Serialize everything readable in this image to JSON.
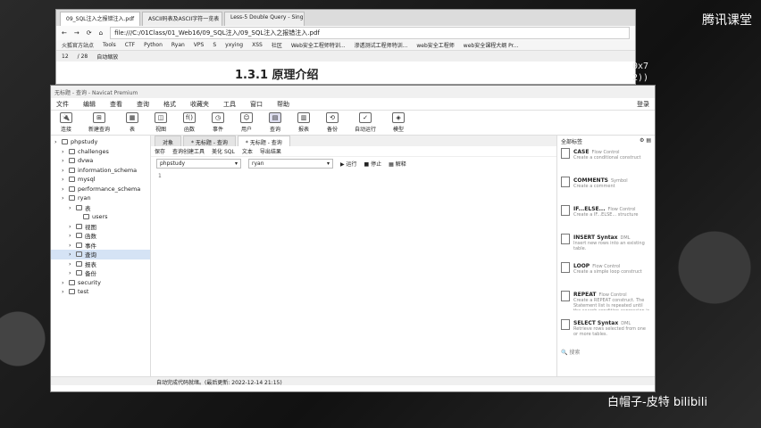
{
  "browser": {
    "tabs": [
      "09_SQL注入之报错注入.pdf",
      "ASCII码表及ASCII字符一览表",
      "Less-5 Double Query - Single Qu"
    ],
    "url": "file:///C:/01Class/01_Web16/09_SQL注入/09_SQL注入之报错注入.pdf",
    "bookmarks": [
      "火狐官方站点",
      "Tools",
      "CTF",
      "Python",
      "Ryan",
      "VPS",
      "S",
      "yxying",
      "XSS",
      "社区",
      "Web安全工程师特训...",
      "渗透测试工程师特训...",
      "web安全工程师",
      "web安全课程大纲 Pr..."
    ],
    "pdf_page": "12",
    "pdf_total": "/ 28",
    "pdf_zoom": "自动缩放",
    "pdf_heading": "1.3.1 原理介绍",
    "watermark": "腾讯课堂",
    "pinyin": "0x7\n2))"
  },
  "navicat": {
    "title": "无标题 - 查询 - Navicat Premium",
    "menu": [
      "文件",
      "编辑",
      "查看",
      "查询",
      "格式",
      "收藏夹",
      "工具",
      "窗口",
      "帮助"
    ],
    "login": "登录",
    "toolbar": [
      {
        "label": "连接",
        "icon": "🔌"
      },
      {
        "label": "新建查询",
        "icon": "⊞"
      },
      {
        "label": "表",
        "icon": "▦"
      },
      {
        "label": "视图",
        "icon": "◫"
      },
      {
        "label": "函数",
        "icon": "f()"
      },
      {
        "label": "事件",
        "icon": "◷"
      },
      {
        "label": "用户",
        "icon": "☺"
      },
      {
        "label": "查询",
        "icon": "▤"
      },
      {
        "label": "报表",
        "icon": "▥"
      },
      {
        "label": "备份",
        "icon": "⟲"
      },
      {
        "label": "自动运行",
        "icon": "✓"
      },
      {
        "label": "模型",
        "icon": "◈"
      }
    ],
    "tree": [
      {
        "label": "phpstudy",
        "level": 0
      },
      {
        "label": "challenges",
        "level": 1
      },
      {
        "label": "dvwa",
        "level": 1
      },
      {
        "label": "information_schema",
        "level": 1
      },
      {
        "label": "mysql",
        "level": 1
      },
      {
        "label": "performance_schema",
        "level": 1
      },
      {
        "label": "ryan",
        "level": 1
      },
      {
        "label": "表",
        "level": 2
      },
      {
        "label": "users",
        "level": 3
      },
      {
        "label": "视图",
        "level": 2
      },
      {
        "label": "函数",
        "level": 2
      },
      {
        "label": "事件",
        "level": 2
      },
      {
        "label": "查询",
        "level": 2
      },
      {
        "label": "报表",
        "level": 2
      },
      {
        "label": "备份",
        "level": 2
      },
      {
        "label": "security",
        "level": 1
      },
      {
        "label": "test",
        "level": 1
      }
    ],
    "doc_tabs": [
      "对象",
      "* 无标题 - 查询",
      "* 无标题 - 查询"
    ],
    "query_tools": [
      "保存",
      "查询创建工具",
      "美化 SQL",
      "文本",
      "导出结果"
    ],
    "conn_select": "phpstudy",
    "db_select": "ryan",
    "run": "运行",
    "stop": "停止",
    "explain": "解释",
    "line_no": "1",
    "right_panel_head": "全部标签",
    "snippets": [
      {
        "title": "CASE",
        "sub": "Flow Control",
        "desc": "Create a conditional construct"
      },
      {
        "title": "COMMENTS",
        "sub": "Symbol",
        "desc": "Create a comment"
      },
      {
        "title": "IF...ELSE...",
        "sub": "Flow Control",
        "desc": "Create a IF...ELSE... structure"
      },
      {
        "title": "INSERT Syntax",
        "sub": "DML",
        "desc": "Insert new rows into an existing table."
      },
      {
        "title": "LOOP",
        "sub": "Flow Control",
        "desc": "Create a simple loop construct"
      },
      {
        "title": "REPEAT",
        "sub": "Flow Control",
        "desc": "Create a REPEAT construct. The Statement list is repeated until the search condition expression is true."
      },
      {
        "title": "SELECT Syntax",
        "sub": "DML",
        "desc": "Retrieve rows selected from one or more tables."
      }
    ],
    "search_placeholder": "搜索",
    "status": "自动完成代码就绪。(最后更新: 2022-12-14 21:15)"
  },
  "signature": "白帽子-皮特 bilibili"
}
